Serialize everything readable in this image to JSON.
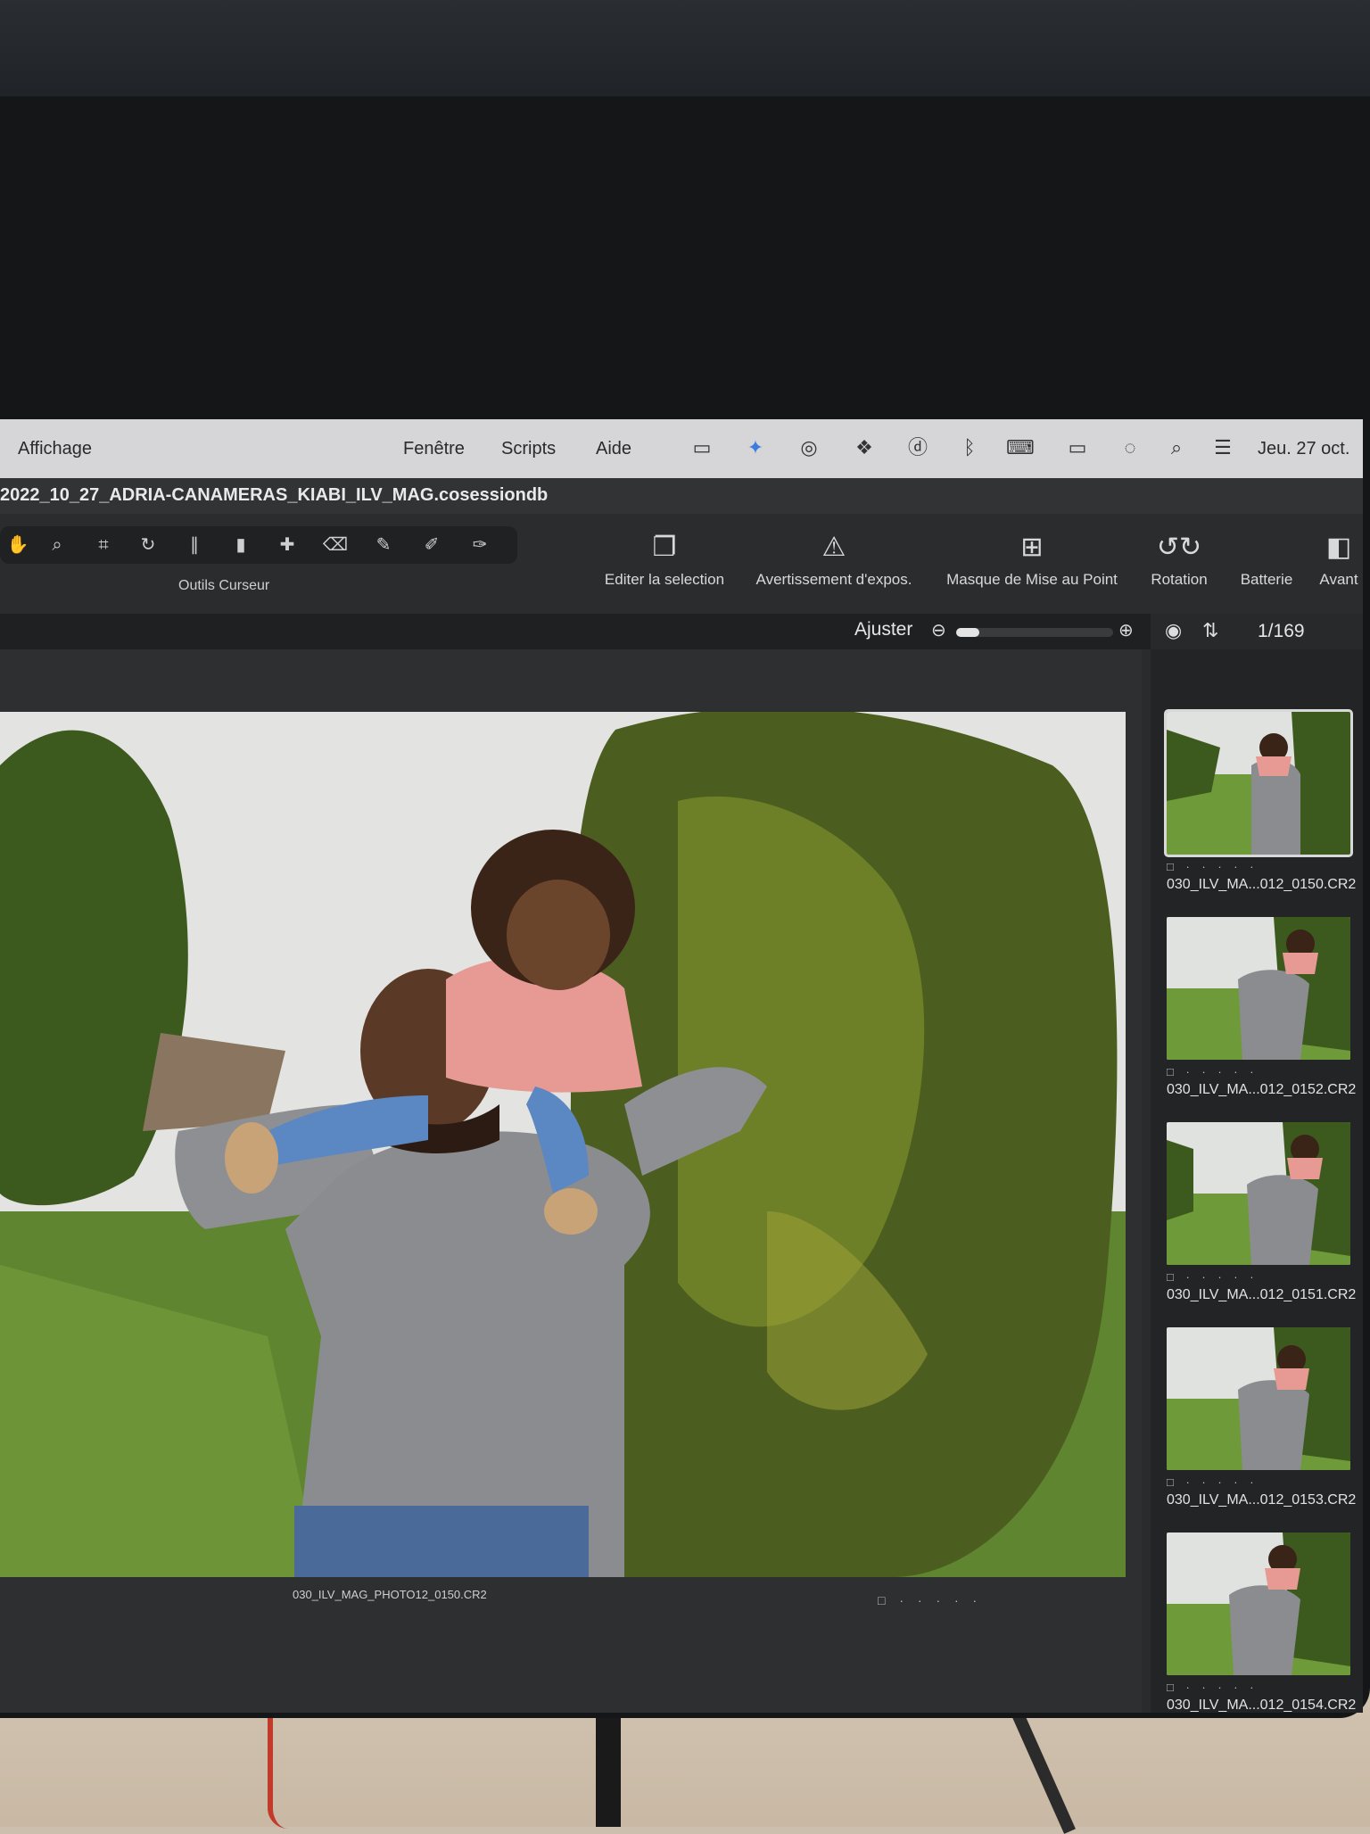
{
  "menubar": {
    "items": [
      "Affichage",
      "Fenêtre",
      "Scripts",
      "Aide"
    ],
    "clock": "Jeu. 27 oct.",
    "status_icons": [
      "display-icon",
      "butterfly-icon",
      "creative-cloud-icon",
      "dropbox-icon",
      "d-icon",
      "bluetooth-icon",
      "keyboard-icon",
      "battery-icon",
      "wifi-off-icon",
      "search-icon",
      "control-center-icon"
    ]
  },
  "window": {
    "title": "2022_10_27_ADRIA-CANAMERAS_KIABI_ILV_MAG.cosessiondb"
  },
  "toolbar": {
    "cursor_tools_label": "Outils Curseur",
    "cursor_tools": [
      "hand-icon",
      "zoom-icon",
      "crop-icon",
      "rotate-icon",
      "keystone-icon",
      "gradient-icon",
      "healing-icon",
      "eraser-icon",
      "picker-icon",
      "brush-icon",
      "pen-icon"
    ],
    "buttons": [
      {
        "label": "Editer la selection",
        "icon": "stack-icon"
      },
      {
        "label": "Avertissement d'expos.",
        "icon": "warning-icon"
      },
      {
        "label": "Masque de Mise au Point",
        "icon": "focus-mask-icon"
      },
      {
        "label": "Rotation",
        "icon": "rotate-icon"
      },
      {
        "label": "Batterie",
        "icon": "battery-icon"
      },
      {
        "label": "Avant",
        "icon": "before-after-icon"
      }
    ]
  },
  "viewer": {
    "ajuster_label": "Ajuster",
    "zoom_fraction": 0.15,
    "filename": "030_ILV_MAG_PHOTO12_0150.CR2",
    "rating": "□ · · · · ·"
  },
  "browser": {
    "counter": "1/169",
    "thumbnails": [
      {
        "name": "030_ILV_MA...012_0150.CR2",
        "rating": "□ · · · · ·",
        "selected": true
      },
      {
        "name": "030_ILV_MA...012_0152.CR2",
        "rating": "□ · · · · ·",
        "selected": false
      },
      {
        "name": "030_ILV_MA...012_0151.CR2",
        "rating": "□ · · · · ·",
        "selected": false
      },
      {
        "name": "030_ILV_MA...012_0153.CR2",
        "rating": "□ · · · · ·",
        "selected": false
      },
      {
        "name": "030_ILV_MA...012_0154.CR2",
        "rating": "□ · · · · ·",
        "selected": false
      }
    ]
  },
  "colors": {
    "menubar": "#d6d6d8",
    "app_bg": "#2a2b2d",
    "accent_butterfly": "#3b7ddd"
  }
}
